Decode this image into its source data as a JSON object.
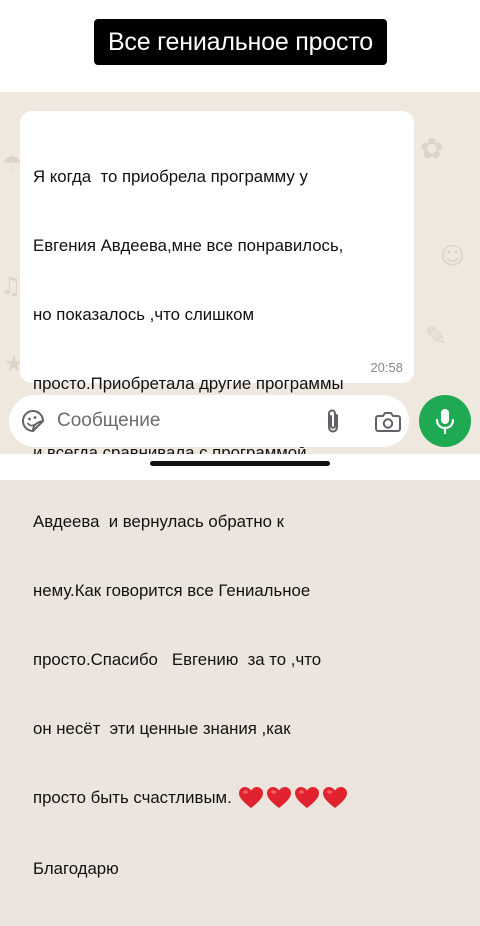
{
  "story": {
    "caption": "Все гениальное просто"
  },
  "message": {
    "lines": [
      "Я когда  то приобрела программу у",
      "Евгения Авдеева,мне все понравилось,",
      "но показалось ,что слишком",
      "просто.Приобретала другие программы",
      "и всегда сравнивала с программой",
      "Авдеева  и вернулась обратно к",
      "нему.Как говорится все Гениальное",
      "просто.Спасибо   Евгению  за то ,что",
      "он несёт  эти ценные знания ,как",
      "просто быть счастливым.",
      "Благодарю"
    ],
    "emoji": [
      "red-heart",
      "red-heart",
      "red-heart",
      "red-heart"
    ],
    "time": "20:58"
  },
  "composer": {
    "placeholder": "Сообщение",
    "icons": [
      "sticker-icon",
      "paperclip-icon",
      "camera-icon",
      "microphone-icon"
    ]
  },
  "colors": {
    "accent_green": "#1ea952",
    "heart_red": "#e0232e",
    "chat_background": "#efe8df",
    "bubble_background": "#ffffff"
  }
}
